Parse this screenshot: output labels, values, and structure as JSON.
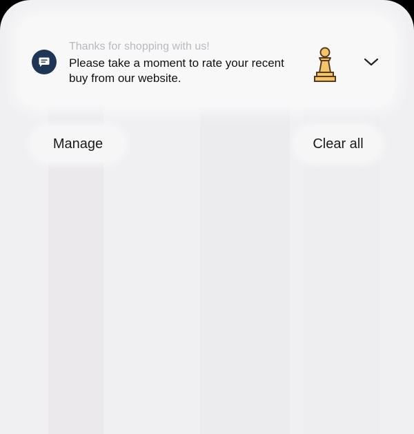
{
  "notification": {
    "title": "Thanks for shopping with us!",
    "body": "Please take a moment to rate your recent buy from our website.",
    "app_icon": "message-icon",
    "thumbnail": "chess-pawn-icon",
    "expand_icon": "chevron-down-icon"
  },
  "actions": {
    "manage_label": "Manage",
    "clear_all_label": "Clear all"
  },
  "colors": {
    "shade_background": "#f0eff1",
    "card_background": "#f8f8f9",
    "app_icon_background": "#1e3556",
    "pawn_fill": "#f2c46e",
    "pawn_outline": "#5a3a1c"
  }
}
